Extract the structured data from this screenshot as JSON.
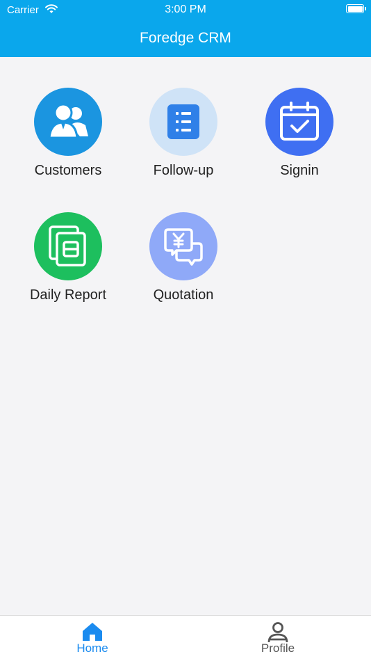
{
  "status_bar": {
    "carrier": "Carrier",
    "time": "3:00 PM"
  },
  "app": {
    "title": "Foredge CRM"
  },
  "menu": [
    {
      "label": "Customers",
      "icon": "customers-icon",
      "color": "#1b95e0"
    },
    {
      "label": "Follow-up",
      "icon": "list-icon",
      "color": "#cfe3f7"
    },
    {
      "label": "Signin",
      "icon": "calendar-check-icon",
      "color": "#3f6ff2"
    },
    {
      "label": "Daily Report",
      "icon": "report-icon",
      "color": "#1dbf5e"
    },
    {
      "label": "Quotation",
      "icon": "quotation-icon",
      "color": "#8fa9f8"
    }
  ],
  "tabs": [
    {
      "label": "Home",
      "icon": "home-icon",
      "active": true
    },
    {
      "label": "Profile",
      "icon": "person-icon",
      "active": false
    }
  ],
  "colors": {
    "accent": "#0aa7ec",
    "tab_active": "#1b8bef",
    "tab_inactive": "#555555"
  }
}
